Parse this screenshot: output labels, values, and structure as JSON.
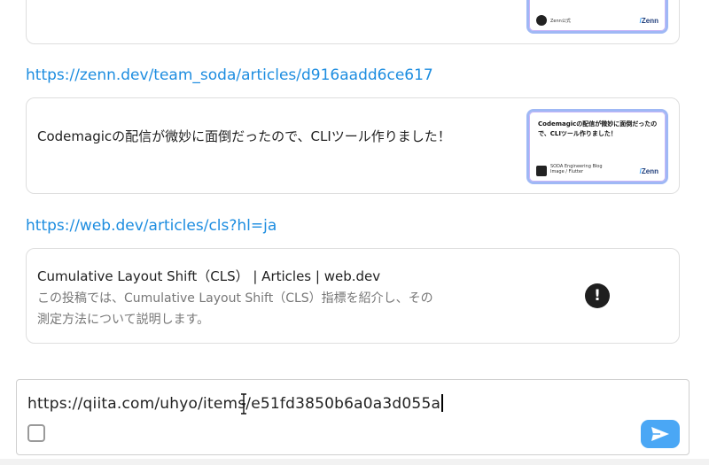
{
  "cards": [
    {
      "thumb": {
        "org": "Zenn公式",
        "logo": "Zenn"
      }
    },
    {
      "url": "https://zenn.dev/team_soda/articles/d916aadd6ce617",
      "title": "Codemagicの配信が微妙に面倒だったので、CLIツール作りました！",
      "thumb": {
        "title": "Codemagicの配信が微妙に面倒だったので、CLIツール作りました！",
        "org_line1": "SODA Engineering Blog",
        "org_line2": "Image / Flutter",
        "logo": "Zenn"
      }
    },
    {
      "url": "https://web.dev/articles/cls?hl=ja",
      "title": "Cumulative Layout Shift（CLS）  |  Articles  |  web.dev",
      "description_line1": "この投稿では、Cumulative Layout Shift（CLS）指標を紹介し、その",
      "description_line2": "測定方法について説明します。",
      "icon": "exclamation-icon"
    }
  ],
  "composer": {
    "value": "https://qiita.com/uhyo/items/e51fd3850b6a0a3d055a",
    "send_icon": "send-icon",
    "accent": "#4aa7f5"
  }
}
